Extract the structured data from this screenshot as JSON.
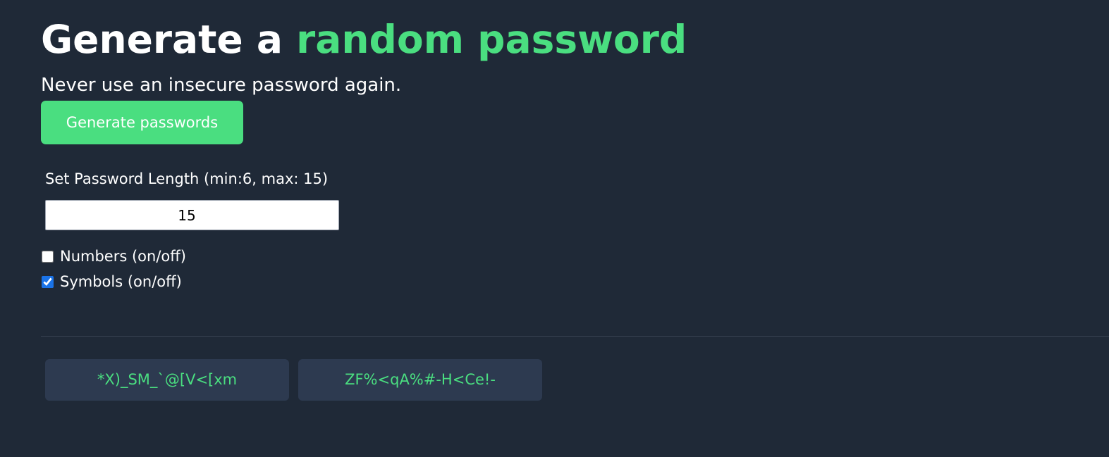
{
  "header": {
    "title_prefix": "Generate a ",
    "title_accent": "random password",
    "subtitle": "Never use an insecure password again."
  },
  "actions": {
    "generate_label": "Generate passwords"
  },
  "settings": {
    "length_label": "Set Password Length (min:6, max: 15)",
    "length_value": "15",
    "numbers_label": "Numbers (on/off)",
    "numbers_checked": false,
    "symbols_label": "Symbols (on/off)",
    "symbols_checked": true
  },
  "results": {
    "passwords": [
      "*X)_SM_`@[V<[xm",
      "ZF%<qA%#-H<Ce!-"
    ]
  },
  "colors": {
    "background": "#1f2937",
    "accent": "#4ade80",
    "password_box": "#2d3a50"
  }
}
